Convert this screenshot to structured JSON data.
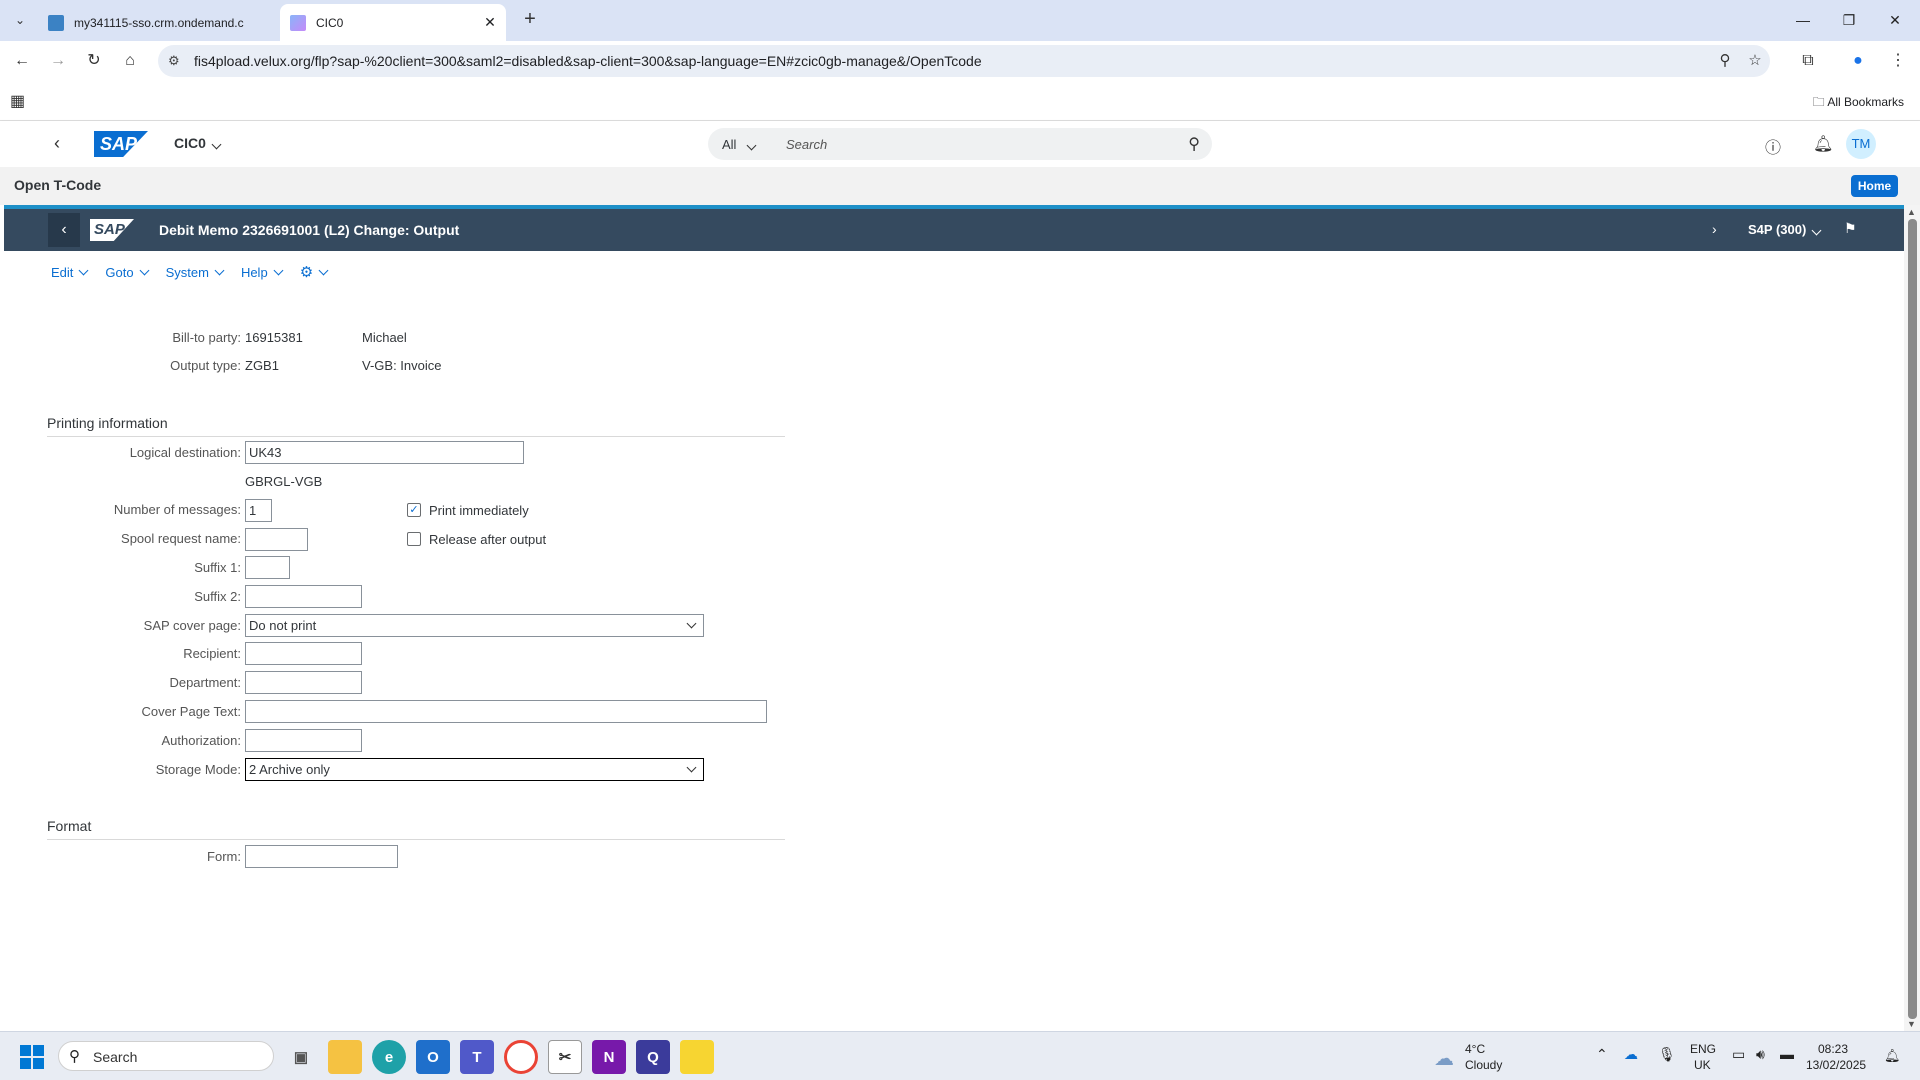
{
  "browser": {
    "tabs": [
      {
        "title": "my341115-sso.crm.ondemand.c",
        "active": false
      },
      {
        "title": "CIC0",
        "active": true
      }
    ],
    "url": "fis4pload.velux.org/flp?sap-%20client=300&saml2=disabled&sap-client=300&sap-language=EN#zcic0gb-manage&/OpenTcode",
    "bookmarks_label": "All Bookmarks"
  },
  "shell": {
    "app_title": "CIC0",
    "search_scope": "All",
    "search_placeholder": "Search",
    "avatar_initials": "TM",
    "logo_text": "SAP"
  },
  "open_tcode": {
    "label": "Open T-Code",
    "home_label": "Home"
  },
  "gui": {
    "title": "Debit Memo 2326691001 (L2) Change: Output",
    "system": "S4P (300)",
    "menu": [
      "Edit",
      "Goto",
      "System",
      "Help"
    ]
  },
  "header_fields": {
    "bill_to_label": "Bill-to party:",
    "bill_to_value": "16915381",
    "bill_to_name": "Michael",
    "output_type_label": "Output type:",
    "output_type_value": "ZGB1",
    "output_type_desc": "V-GB: Invoice"
  },
  "printing": {
    "section_title": "Printing information",
    "logical_destination_label": "Logical destination:",
    "logical_destination_value": "UK43",
    "logical_destination_desc": "GBRGL-VGB",
    "num_messages_label": "Number of messages:",
    "num_messages_value": "1",
    "print_immediately_label": "Print immediately",
    "print_immediately_checked": true,
    "release_after_output_label": "Release after output",
    "release_after_output_checked": false,
    "spool_request_label": "Spool request name:",
    "spool_request_value": "",
    "suffix1_label": "Suffix 1:",
    "suffix1_value": "",
    "suffix2_label": "Suffix 2:",
    "suffix2_value": "",
    "cover_page_label": "SAP cover page:",
    "cover_page_value": "Do not print",
    "recipient_label": "Recipient:",
    "recipient_value": "",
    "department_label": "Department:",
    "department_value": "",
    "cover_text_label": "Cover Page Text:",
    "cover_text_value": "",
    "authorization_label": "Authorization:",
    "authorization_value": "",
    "storage_mode_label": "Storage Mode:",
    "storage_mode_value": "2 Archive only"
  },
  "format": {
    "section_title": "Format",
    "form_label": "Form:",
    "form_value": ""
  },
  "taskbar": {
    "search_placeholder": "Search",
    "weather_temp": "4°C",
    "weather_desc": "Cloudy",
    "lang_top": "ENG",
    "lang_bottom": "UK",
    "time": "08:23",
    "date": "13/02/2025"
  }
}
